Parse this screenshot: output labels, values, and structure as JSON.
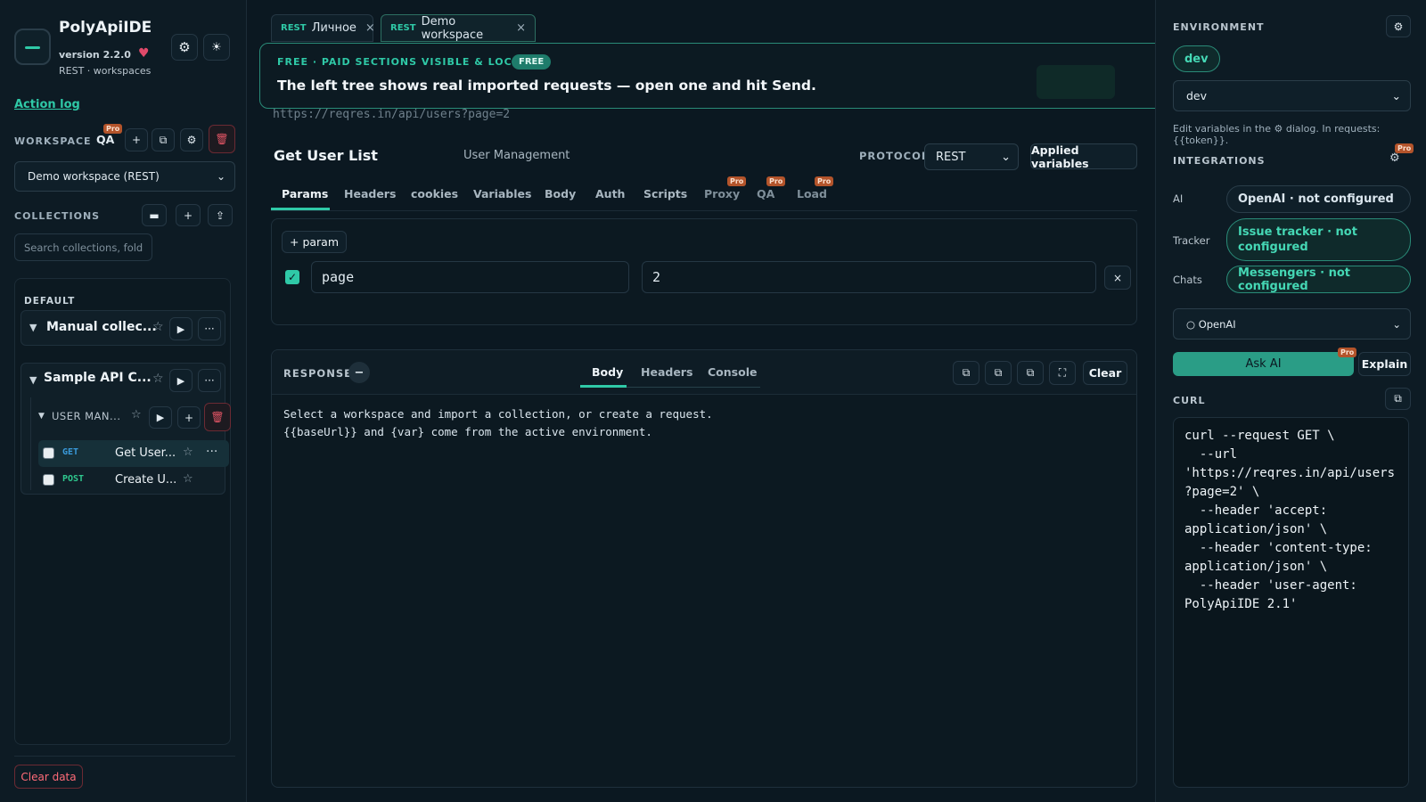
{
  "app": {
    "name": "PolyApiIDE",
    "version": "version 2.2.0",
    "subtitle": "REST · workspaces",
    "action_log": "Action log",
    "clear_data": "Clear data"
  },
  "workspace": {
    "label": "WORKSPACE",
    "qa_label": "QA",
    "pro_badge": "Pro",
    "selected": "Demo workspace (REST)"
  },
  "collections": {
    "label": "COLLECTIONS",
    "search_placeholder": "Search collections, fold",
    "default_label": "DEFAULT",
    "items": [
      {
        "title": "Manual collec..."
      },
      {
        "title": "Sample API C..."
      }
    ],
    "folder": {
      "title": "USER MAN..."
    },
    "requests": [
      {
        "method": "GET",
        "name": "Get User...",
        "active": true
      },
      {
        "method": "POST",
        "name": "Create U...",
        "active": false
      }
    ]
  },
  "tabs": [
    {
      "protocol": "REST",
      "label": "Личное",
      "active": false
    },
    {
      "protocol": "REST",
      "label": "Demo workspace",
      "active": true
    }
  ],
  "banner": {
    "headline": "FREE · PAID SECTIONS VISIBLE & LOCKED",
    "badge": "FREE",
    "message": "The left tree shows real imported requests — open one and hit Send."
  },
  "request": {
    "url": "https://reqres.in/api/users?page=2",
    "title": "Get User List",
    "folder": "User Management",
    "protocol_label": "PROTOCOL",
    "protocol": "REST",
    "applied_variables": "Applied variables",
    "sub_tabs": [
      {
        "label": "Params",
        "active": true,
        "pro": false
      },
      {
        "label": "Headers",
        "active": false,
        "pro": false
      },
      {
        "label": "cookies",
        "active": false,
        "pro": false
      },
      {
        "label": "Variables",
        "active": false,
        "pro": false
      },
      {
        "label": "Body",
        "active": false,
        "pro": false
      },
      {
        "label": "Auth",
        "active": false,
        "pro": false
      },
      {
        "label": "Scripts",
        "active": false,
        "pro": false
      },
      {
        "label": "Proxy",
        "active": false,
        "pro": true
      },
      {
        "label": "QA",
        "active": false,
        "pro": true
      },
      {
        "label": "Load",
        "active": false,
        "pro": true
      }
    ],
    "add_param": "+ param",
    "params": [
      {
        "key": "page",
        "value": "2",
        "enabled": true
      }
    ]
  },
  "response": {
    "label": "RESPONSE",
    "tabs": [
      {
        "label": "Body",
        "active": true
      },
      {
        "label": "Headers",
        "active": false
      },
      {
        "label": "Console",
        "active": false
      }
    ],
    "clear": "Clear",
    "body_line1": "Select a workspace and import a collection, or create a request.",
    "body_line2": "{{baseUrl}} and {var} come from the active environment."
  },
  "environment": {
    "label": "ENVIRONMENT",
    "active_pill": "dev",
    "selected": "dev",
    "hint": "Edit variables in the ⚙ dialog. In requests: {{token}}."
  },
  "integrations": {
    "label": "INTEGRATIONS",
    "pro_badge": "Pro",
    "rows": [
      {
        "label": "AI",
        "value": "OpenAI · not configured"
      },
      {
        "label": "Tracker",
        "value": "Issue tracker · not configured"
      },
      {
        "label": "Chats",
        "value": "Messengers · not configured"
      }
    ],
    "ai_select": "○ OpenAI",
    "ask_ai": "Ask AI",
    "explain": "Explain"
  },
  "curl": {
    "label": "CURL",
    "text": "curl --request GET \\\n  --url\n'https://reqres.in/api/users\n?page=2' \\\n  --header 'accept:\napplication/json' \\\n  --header 'content-type:\napplication/json' \\\n  --header 'user-agent:\nPolyApiIDE 2.1'"
  },
  "colors": {
    "accent": "#2fc9a7",
    "background": "#0b1821",
    "danger": "#e25565",
    "pro_badge": "#b3542b"
  },
  "icons": [
    "gear-icon",
    "sun-icon",
    "heart-icon",
    "plus-icon",
    "copy-icon",
    "trash-icon",
    "folder-icon",
    "upload-icon",
    "play-icon",
    "star-icon",
    "more-icon",
    "close-icon",
    "fullscreen-icon",
    "chevron-down-icon"
  ]
}
